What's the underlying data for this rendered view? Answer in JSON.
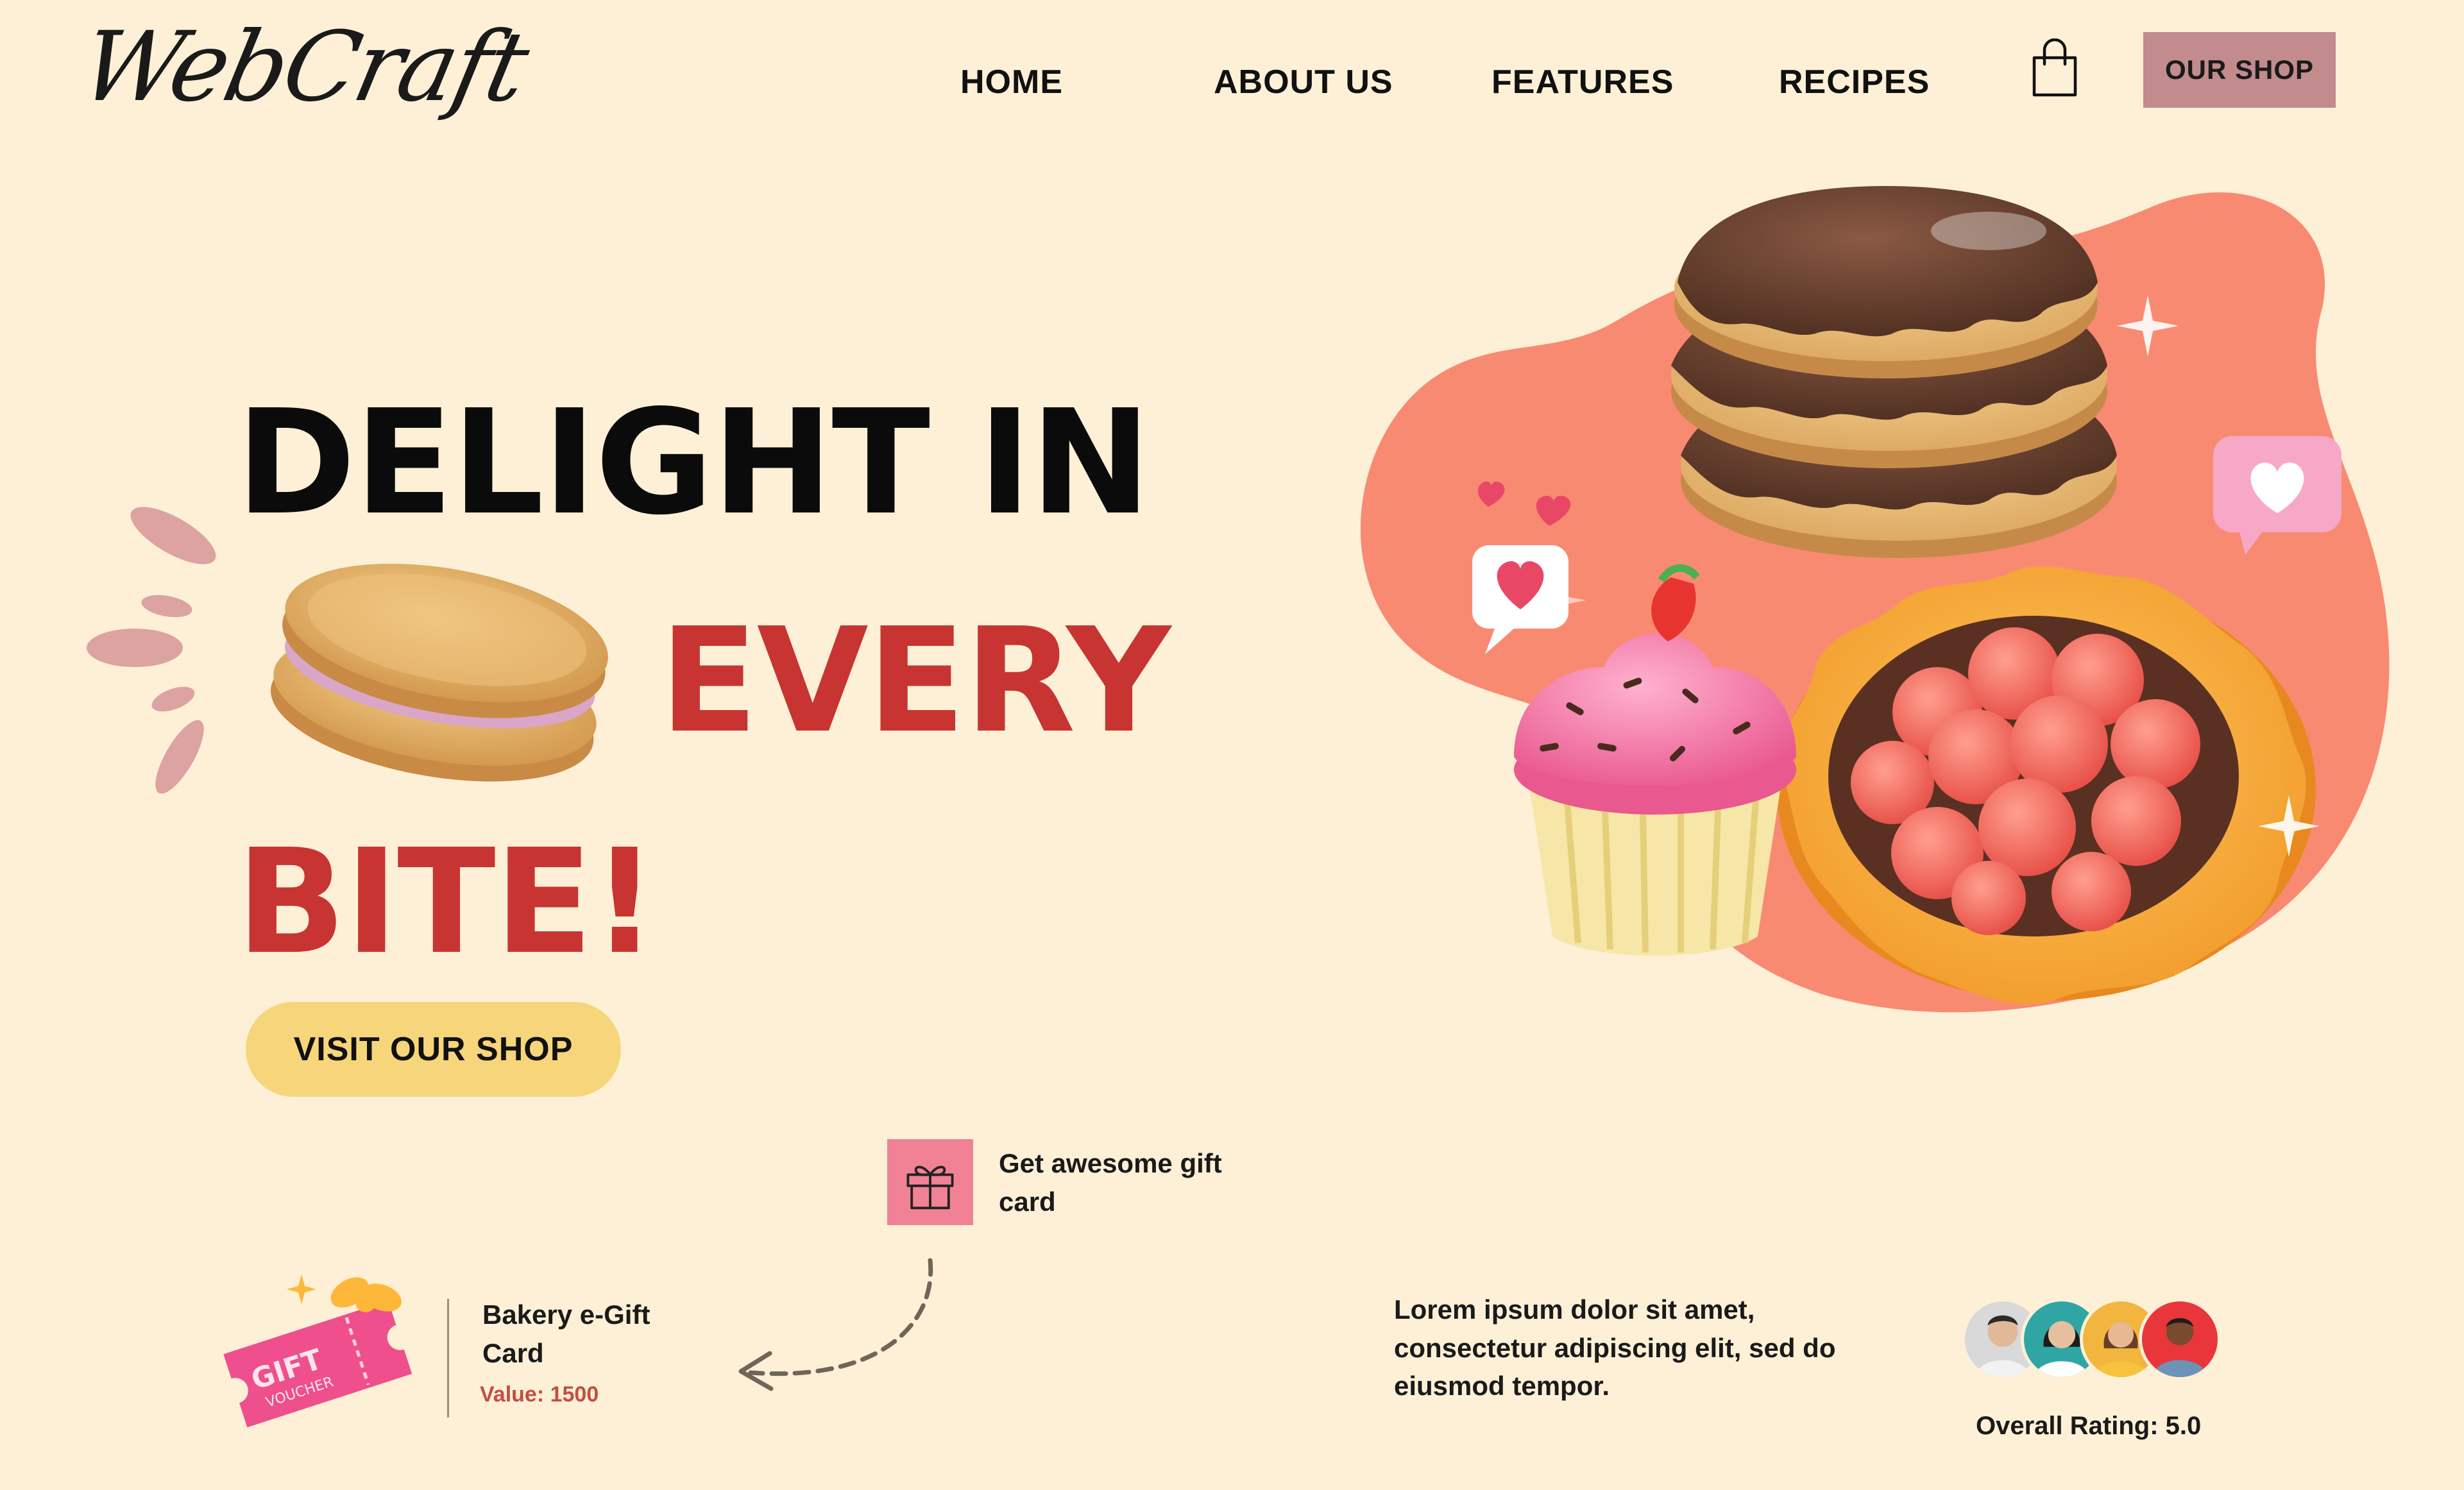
{
  "header": {
    "logo": "WebCraft",
    "nav": [
      "HOME",
      "ABOUT US",
      "FEATURES",
      "RECIPES"
    ],
    "cart_icon": "shopping-bag-icon",
    "shop_button": "OUR SHOP"
  },
  "hero": {
    "line1": "DELIGHT IN",
    "line2": "EVERY",
    "line3": "BITE!",
    "cta": "VISIT OUR SHOP"
  },
  "gift": {
    "icon": "gift-box-icon",
    "text": "Get awesome gift card",
    "card_title": "Bakery e-Gift Card",
    "card_value": "Value: 1500",
    "voucher_word1": "GIFT",
    "voucher_word2": "VOUCHER"
  },
  "testimonial": {
    "text": "Lorem ipsum dolor sit amet, consectetur adipiscing elit, sed do eiusmod tempor.",
    "rating": "Overall Rating: 5.0"
  },
  "colors": {
    "background": "#fdf0d6",
    "accent_red": "#c73432",
    "button_yellow": "#f7d57a",
    "shop_button": "#c28b8d",
    "blob": "#f98a72",
    "gift_tile": "#f18295"
  }
}
